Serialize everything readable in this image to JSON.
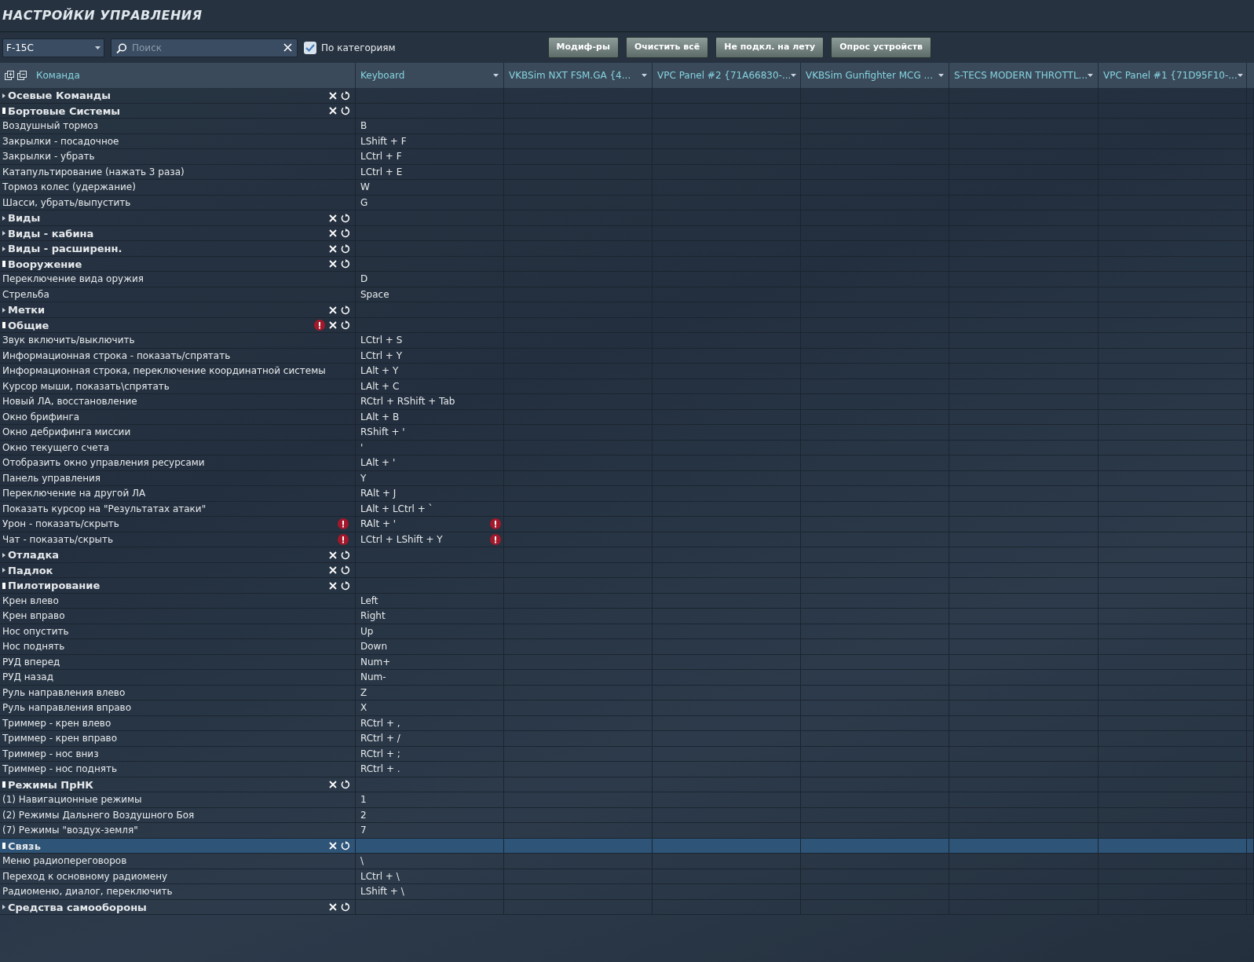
{
  "title": "НАСТРОЙКИ УПРАВЛЕНИЯ",
  "toolbar": {
    "aircraft": "F-15C",
    "search": {
      "placeholder": "Поиск"
    },
    "by_category": {
      "label": "По категориям",
      "checked": true
    },
    "buttons": [
      "Модиф-ры",
      "Очистить всё",
      "Не подкл. на лету",
      "Опрос устройств"
    ]
  },
  "table": {
    "columns": [
      {
        "label": "Команда",
        "kind": "command"
      },
      {
        "label": "Keyboard",
        "kind": "device"
      },
      {
        "label": "VKBSim NXT FSM.GA  {4...",
        "kind": "device"
      },
      {
        "label": "VPC Panel #2 {71A66830-...",
        "kind": "device"
      },
      {
        "label": "VKBSim Gunfighter MCG ...",
        "kind": "device"
      },
      {
        "label": "S-TECS MODERN THROTTL...",
        "kind": "device"
      },
      {
        "label": "VPC Panel #1 {71D95F10-...",
        "kind": "device"
      }
    ],
    "rows": [
      {
        "name": "Осевые Команды",
        "expanded": false,
        "selected": false,
        "conflict": false,
        "children": []
      },
      {
        "name": "Бортовые Системы",
        "expanded": true,
        "selected": false,
        "conflict": false,
        "children": [
          {
            "name": "Воздушный тормоз",
            "keyboard": "B",
            "selected": false,
            "conflict": false
          },
          {
            "name": "Закрылки - посадочное",
            "keyboard": "LShift + F",
            "selected": false,
            "conflict": false
          },
          {
            "name": "Закрылки - убрать",
            "keyboard": "LCtrl + F",
            "selected": false,
            "conflict": false
          },
          {
            "name": "Катапультирование (нажать 3 раза)",
            "keyboard": "LCtrl + E",
            "selected": false,
            "conflict": false
          },
          {
            "name": "Тормоз колес (удержание)",
            "keyboard": "W",
            "selected": false,
            "conflict": false
          },
          {
            "name": "Шасси, убрать/выпустить",
            "keyboard": "G",
            "selected": false,
            "conflict": false
          }
        ]
      },
      {
        "name": "Виды",
        "expanded": false,
        "selected": false,
        "conflict": false,
        "children": []
      },
      {
        "name": "Виды - кабина",
        "expanded": false,
        "selected": false,
        "conflict": false,
        "children": []
      },
      {
        "name": "Виды - расширенн.",
        "expanded": false,
        "selected": false,
        "conflict": false,
        "children": []
      },
      {
        "name": "Вооружение",
        "expanded": true,
        "selected": false,
        "conflict": false,
        "children": [
          {
            "name": "Переключение вида оружия",
            "keyboard": "D",
            "selected": false,
            "conflict": false
          },
          {
            "name": "Стрельба",
            "keyboard": "Space",
            "selected": false,
            "conflict": false
          }
        ]
      },
      {
        "name": "Метки",
        "expanded": false,
        "selected": false,
        "conflict": false,
        "children": []
      },
      {
        "name": "Общие",
        "expanded": true,
        "selected": false,
        "conflict": true,
        "children": [
          {
            "name": "Звук включить/выключить",
            "keyboard": "LCtrl + S",
            "selected": false,
            "conflict": false
          },
          {
            "name": "Информационная строка - показать/спрятать",
            "keyboard": "LCtrl + Y",
            "selected": false,
            "conflict": false
          },
          {
            "name": "Информационная строка, переключение координатной системы",
            "keyboard": "LAlt + Y",
            "selected": false,
            "conflict": false
          },
          {
            "name": "Курсор мыши, показать\\спрятать",
            "keyboard": "LAlt + C",
            "selected": false,
            "conflict": false
          },
          {
            "name": "Новый ЛА, восстановление",
            "keyboard": "RCtrl + RShift + Tab",
            "selected": false,
            "conflict": false
          },
          {
            "name": "Окно брифинга",
            "keyboard": "LAlt + B",
            "selected": false,
            "conflict": false
          },
          {
            "name": "Окно дебрифинга миссии",
            "keyboard": "RShift + '",
            "selected": false,
            "conflict": false
          },
          {
            "name": "Окно текущего счета",
            "keyboard": "'",
            "selected": false,
            "conflict": false
          },
          {
            "name": "Отобразить окно управления ресурсами",
            "keyboard": "LAlt + '",
            "selected": false,
            "conflict": false
          },
          {
            "name": "Панель управления",
            "keyboard": "Y",
            "selected": false,
            "conflict": false
          },
          {
            "name": "Переключение на другой ЛА",
            "keyboard": "RAlt + J",
            "selected": false,
            "conflict": false
          },
          {
            "name": "Показать курсор на \"Результатах атаки\"",
            "keyboard": "LAlt + LCtrl + `",
            "selected": false,
            "conflict": false
          },
          {
            "name": "Урон - показать/скрыть",
            "keyboard": "RAlt + '",
            "selected": false,
            "conflict": true
          },
          {
            "name": "Чат - показать/скрыть",
            "keyboard": "LCtrl + LShift + Y",
            "selected": false,
            "conflict": true
          }
        ]
      },
      {
        "name": "Отладка",
        "expanded": false,
        "selected": false,
        "conflict": false,
        "children": []
      },
      {
        "name": "Падлок",
        "expanded": false,
        "selected": false,
        "conflict": false,
        "children": []
      },
      {
        "name": "Пилотирование",
        "expanded": true,
        "selected": false,
        "conflict": false,
        "children": [
          {
            "name": "Крен влево",
            "keyboard": "Left",
            "selected": false,
            "conflict": false
          },
          {
            "name": "Крен вправо",
            "keyboard": "Right",
            "selected": false,
            "conflict": false
          },
          {
            "name": "Нос опустить",
            "keyboard": "Up",
            "selected": false,
            "conflict": false
          },
          {
            "name": "Нос поднять",
            "keyboard": "Down",
            "selected": false,
            "conflict": false
          },
          {
            "name": "РУД вперед",
            "keyboard": "Num+",
            "selected": false,
            "conflict": false
          },
          {
            "name": "РУД назад",
            "keyboard": "Num-",
            "selected": false,
            "conflict": false
          },
          {
            "name": "Руль направления влево",
            "keyboard": "Z",
            "selected": false,
            "conflict": false
          },
          {
            "name": "Руль направления вправо",
            "keyboard": "X",
            "selected": false,
            "conflict": false
          },
          {
            "name": "Триммер - крен влево",
            "keyboard": "RCtrl + ,",
            "selected": false,
            "conflict": false
          },
          {
            "name": "Триммер - крен вправо",
            "keyboard": "RCtrl + /",
            "selected": false,
            "conflict": false
          },
          {
            "name": "Триммер - нос вниз",
            "keyboard": "RCtrl + ;",
            "selected": false,
            "conflict": false
          },
          {
            "name": "Триммер - нос поднять",
            "keyboard": "RCtrl + .",
            "selected": false,
            "conflict": false
          }
        ]
      },
      {
        "name": "Режимы ПрНК",
        "expanded": true,
        "selected": false,
        "conflict": false,
        "children": [
          {
            "name": "(1) Навигационные режимы",
            "keyboard": "1",
            "selected": false,
            "conflict": false
          },
          {
            "name": "(2) Режимы Дальнего Воздушного Боя",
            "keyboard": "2",
            "selected": false,
            "conflict": false
          },
          {
            "name": "(7) Режимы \"воздух-земля\"",
            "keyboard": "7",
            "selected": false,
            "conflict": false
          }
        ]
      },
      {
        "name": "Связь",
        "expanded": true,
        "selected": true,
        "conflict": false,
        "children": [
          {
            "name": "Меню радиопереговоров",
            "keyboard": "\\",
            "selected": false,
            "conflict": false
          },
          {
            "name": "Переход к основному радиомену",
            "keyboard": "LCtrl + \\",
            "selected": false,
            "conflict": false
          },
          {
            "name": "Радиоменю, диалог, переключить",
            "keyboard": "LShift + \\",
            "selected": false,
            "conflict": false
          }
        ]
      },
      {
        "name": "Средства самообороны",
        "expanded": false,
        "selected": false,
        "conflict": false,
        "children": []
      }
    ]
  }
}
